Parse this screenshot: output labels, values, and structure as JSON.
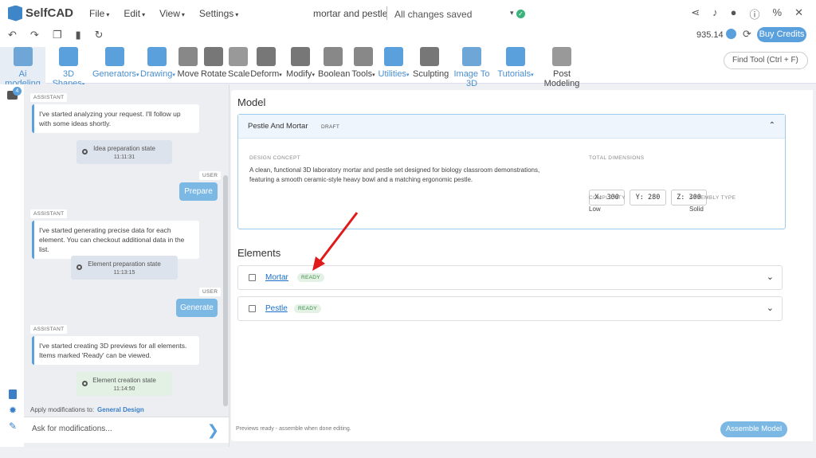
{
  "app": {
    "name": "SelfCAD"
  },
  "menu": [
    "File",
    "Edit",
    "View",
    "Settings"
  ],
  "document": {
    "title": "mortar and pestle",
    "status": "All changes saved"
  },
  "credits": {
    "amount": "935.14",
    "buy_label": "Buy Credits"
  },
  "tools": [
    {
      "label": "Ai modeling"
    },
    {
      "label": "3D Shapes"
    },
    {
      "label": "Generators"
    },
    {
      "label": "Drawing"
    },
    {
      "label": "Move"
    },
    {
      "label": "Rotate"
    },
    {
      "label": "Scale"
    },
    {
      "label": "Deform"
    },
    {
      "label": "Modify"
    },
    {
      "label": "Boolean"
    },
    {
      "label": "Tools"
    },
    {
      "label": "Utilities"
    },
    {
      "label": "Sculpting"
    },
    {
      "label": "Image To 3D"
    },
    {
      "label": "Tutorials"
    },
    {
      "label": "Post Modeling"
    }
  ],
  "find_tool": {
    "placeholder": "Find Tool (Ctrl + F)"
  },
  "chat": {
    "badge": "4",
    "messages": [
      {
        "tag": "ASSISTANT",
        "text": "I've started analyzing your request. I'll follow up with some ideas shortly."
      },
      {
        "state": "Idea preparation state",
        "time": "11:11:31"
      },
      {
        "tag": "USER",
        "button": "Prepare"
      },
      {
        "tag": "ASSISTANT",
        "text": "I've started generating precise data for each element. You can checkout additional data in the list."
      },
      {
        "state": "Element preparation state",
        "time": "11:13:15"
      },
      {
        "tag": "USER",
        "button": "Generate"
      },
      {
        "tag": "ASSISTANT",
        "text": "I've started creating 3D previews for all elements. Items marked 'Ready' can be viewed."
      },
      {
        "state": "Element creation state",
        "time": "11:14:50"
      }
    ],
    "apply_label": "Apply modifications to:",
    "apply_target": "General Design",
    "ask_placeholder": "Ask for modifications..."
  },
  "model": {
    "heading": "Model",
    "title": "Pestle And Mortar",
    "status": "DRAFT",
    "concept_label": "DESIGN CONCEPT",
    "concept": "A clean, functional 3D laboratory mortar and pestle set designed for biology classroom demonstrations, featuring a smooth ceramic-style heavy bowl and a matching ergonomic pestle.",
    "dims_label": "TOTAL DIMENSIONS",
    "dims": {
      "x": "X: 300",
      "y": "Y: 280",
      "z": "Z: 300"
    },
    "complexity_label": "COMPLEXITY",
    "complexity": "Low",
    "assembly_label": "ASSEMBLY TYPE",
    "assembly": "Solid"
  },
  "elements": {
    "heading": "Elements",
    "items": [
      {
        "name": "Mortar",
        "status": "READY"
      },
      {
        "name": "Pestle",
        "status": "READY"
      }
    ]
  },
  "footer": {
    "note": "Previews ready - assemble when done editing.",
    "assemble_label": "Assemble Model"
  },
  "colors": {
    "accent": "#5aa0dc",
    "ready": "#3b8a4b",
    "arrow": "#e0191b"
  }
}
